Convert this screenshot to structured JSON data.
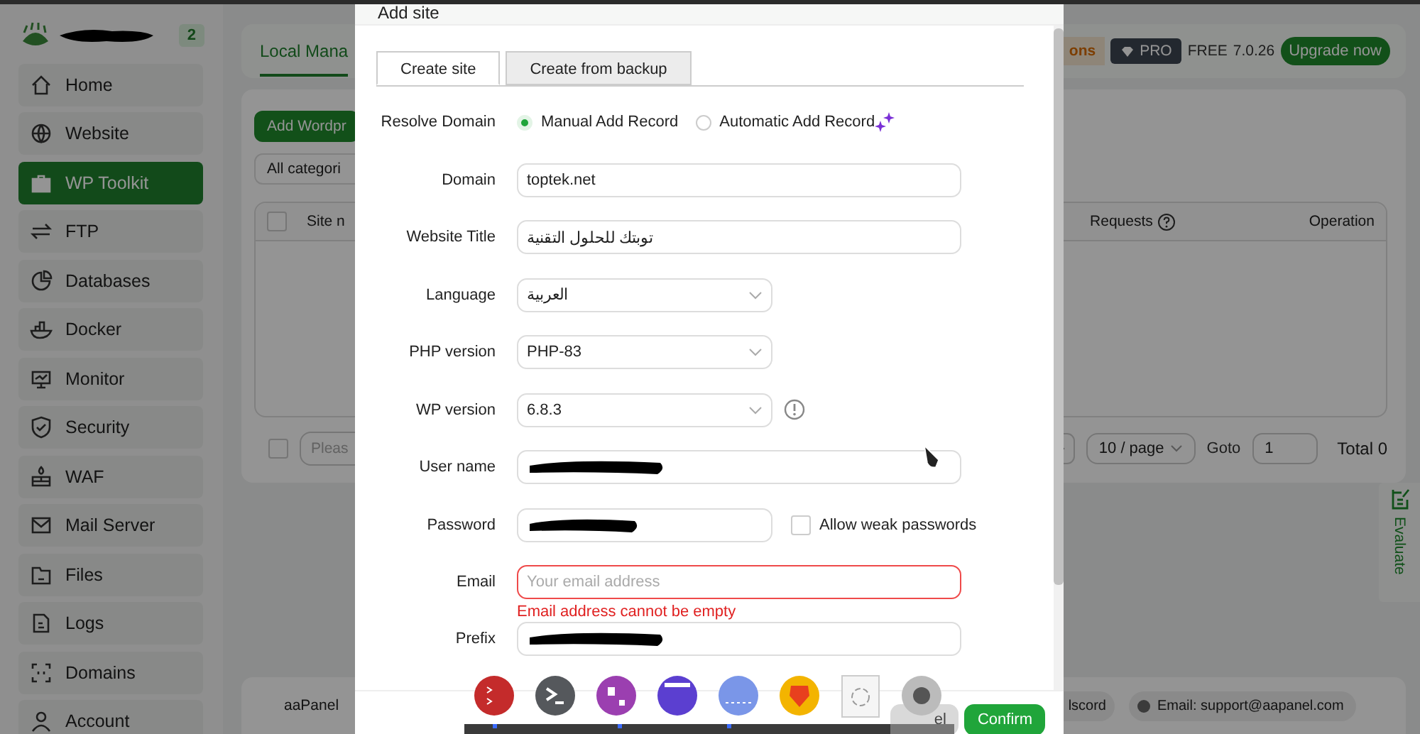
{
  "sidebar": {
    "badge": "2",
    "items": [
      {
        "label": "Home",
        "selected": false
      },
      {
        "label": "Website",
        "selected": false
      },
      {
        "label": "WP Toolkit",
        "selected": true
      },
      {
        "label": "FTP",
        "selected": false
      },
      {
        "label": "Databases",
        "selected": false
      },
      {
        "label": "Docker",
        "selected": false
      },
      {
        "label": "Monitor",
        "selected": false
      },
      {
        "label": "Security",
        "selected": false
      },
      {
        "label": "WAF",
        "selected": false
      },
      {
        "label": "Mail Server",
        "selected": false
      },
      {
        "label": "Files",
        "selected": false
      },
      {
        "label": "Logs",
        "selected": false
      },
      {
        "label": "Domains",
        "selected": false
      },
      {
        "label": "Account",
        "selected": false
      }
    ]
  },
  "header": {
    "tab": "Local Mana",
    "promo": "ons",
    "pro_badge": "PRO",
    "edition": "FREE",
    "version": "7.0.26",
    "upgrade": "Upgrade now"
  },
  "content": {
    "add_button": "Add Wordpr",
    "category_filter": "All categori",
    "table": {
      "select_all_checked": false,
      "columns": [
        "Site n",
        "Requests",
        "Operation"
      ]
    },
    "pagination": {
      "select_checked": false,
      "search_placeholder": "Pleas",
      "page_size": "10 / page",
      "goto_label": "Goto",
      "goto_value": "1",
      "total": "Total 0"
    }
  },
  "footer": {
    "company": "aaPanel",
    "discord": "lscord",
    "email": "Email: support@aapanel.com"
  },
  "evaluate": "Evaluate",
  "dialog": {
    "title": "Add site",
    "tabs": [
      {
        "label": "Create site",
        "selected": true
      },
      {
        "label": "Create from backup",
        "selected": false
      }
    ],
    "fields": [
      {
        "kind": "radio",
        "label": "Resolve Domain",
        "options": [
          {
            "label": "Manual Add Record",
            "selected": true
          },
          {
            "label": "Automatic Add Record",
            "selected": false
          }
        ]
      },
      {
        "kind": "text",
        "label": "Domain",
        "value": "toptek.net"
      },
      {
        "kind": "text",
        "label": "Website Title",
        "value": "توبتك للحلول التقنية"
      },
      {
        "kind": "select",
        "label": "Language",
        "value": "العربية"
      },
      {
        "kind": "select",
        "label": "PHP version",
        "value": "PHP-83"
      },
      {
        "kind": "select",
        "label": "WP version",
        "value": "6.8.3",
        "info": true
      },
      {
        "kind": "redacted",
        "label": "User name"
      },
      {
        "kind": "redacted-short",
        "label": "Password",
        "checkbox": {
          "label": "Allow weak passwords",
          "checked": false
        }
      },
      {
        "kind": "text",
        "label": "Email",
        "placeholder": "Your email address",
        "error": "Email address cannot be empty"
      },
      {
        "kind": "redacted",
        "label": "Prefix"
      }
    ],
    "cancel": "el",
    "confirm": "Confirm"
  }
}
